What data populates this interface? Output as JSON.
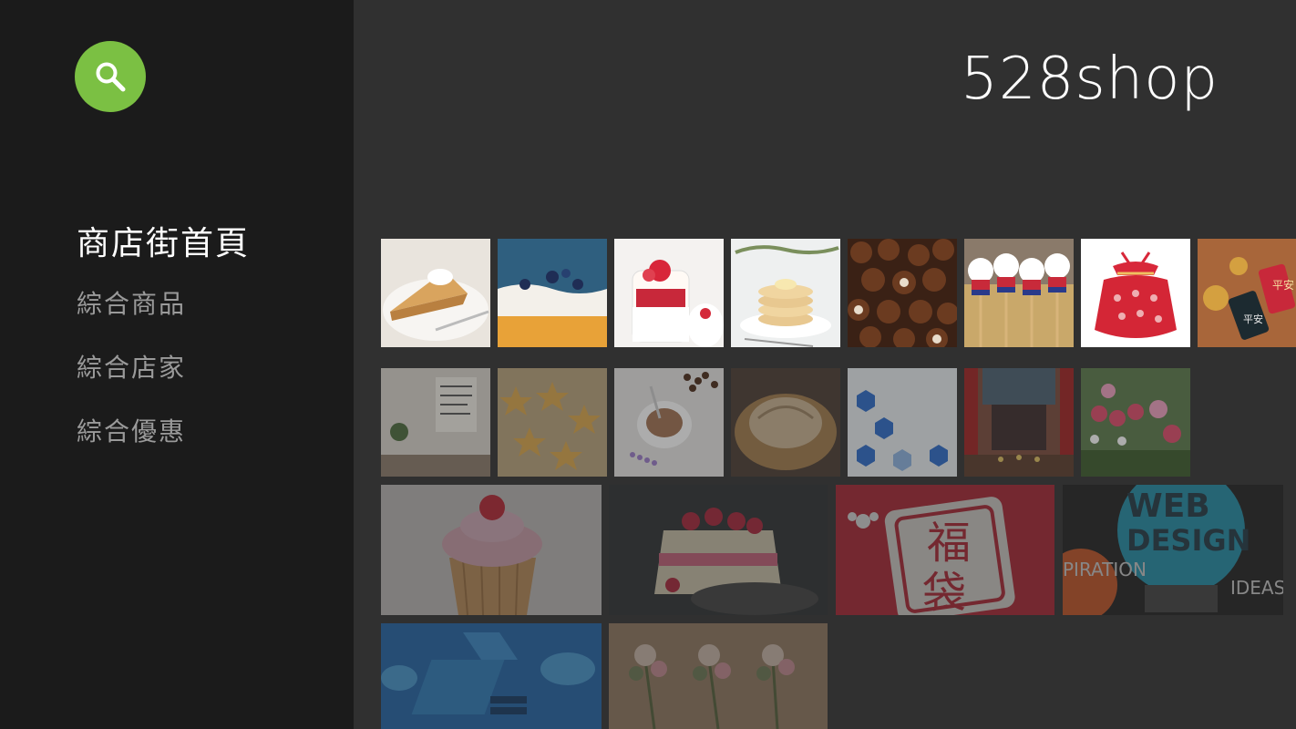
{
  "app": {
    "brand": "528shop"
  },
  "sidebar": {
    "search_icon": "search-icon",
    "items": [
      {
        "label": "商店街首頁",
        "active": true
      },
      {
        "label": "綜合商品",
        "active": false
      },
      {
        "label": "綜合店家",
        "active": false
      },
      {
        "label": "綜合優惠",
        "active": false
      }
    ]
  },
  "grid": {
    "row1": [
      "cake-slice",
      "blueberry-cake",
      "strawberry-pudding",
      "pancakes",
      "chocolates",
      "lollipop-dolls",
      "red-gift-bag",
      "amulet-charms"
    ],
    "row2": [
      "cafe-interior",
      "star-cookies",
      "coffee-cup",
      "bread-basket",
      "blue-hexagons",
      "temple",
      "flower-shop"
    ],
    "row3": [
      "cupcake",
      "raspberry-cake",
      "fukubukuro-sign",
      "web-design-poster"
    ],
    "row4": [
      "cloud-network",
      "bouquets"
    ],
    "tile_texts": {
      "fukubukuro_char1": "福",
      "fukubukuro_char2": "袋",
      "web_design_line1": "WEB",
      "web_design_line2": "DESIGN",
      "web_design_left": "PIRATION",
      "web_design_right": "IDEAS",
      "amulet_text1": "平安",
      "amulet_text2": "平安"
    }
  },
  "colors": {
    "accent": "#7bc043",
    "sidebar_bg": "#1b1b1b",
    "main_bg": "#303030"
  }
}
